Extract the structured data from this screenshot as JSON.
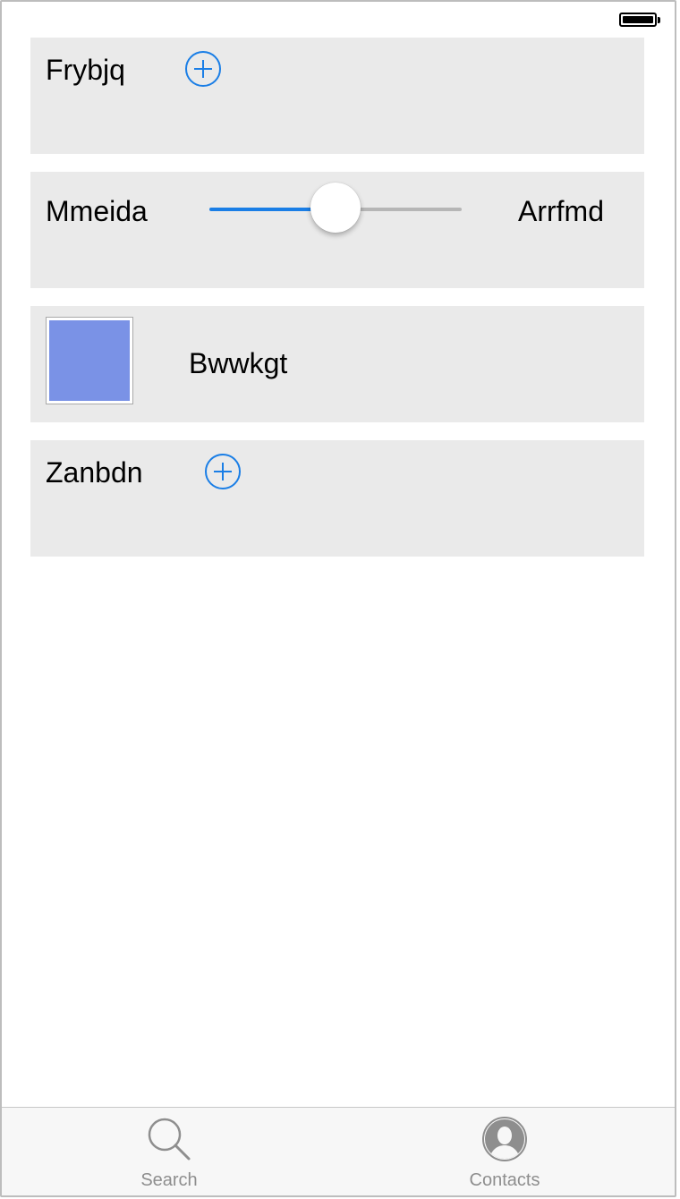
{
  "status_bar": {
    "battery_icon": "battery-full-icon"
  },
  "cells": {
    "row1": {
      "label": "Frybjq",
      "icon": "add-circle-icon"
    },
    "row2": {
      "min_label": "Mmeida",
      "max_label": "Arrfmd",
      "slider_value": 0.5
    },
    "row3": {
      "label": "Bwwkgt",
      "swatch_color": "#7a92e6"
    },
    "row4": {
      "label": "Zanbdn",
      "icon": "add-circle-icon"
    }
  },
  "tab_bar": {
    "tabs": [
      {
        "label": "Search",
        "icon": "search-icon"
      },
      {
        "label": "Contacts",
        "icon": "contacts-icon"
      }
    ]
  },
  "colors": {
    "accent": "#1a7ee6",
    "cell_background": "#eaeaea",
    "tab_label": "#8e8e8e"
  }
}
